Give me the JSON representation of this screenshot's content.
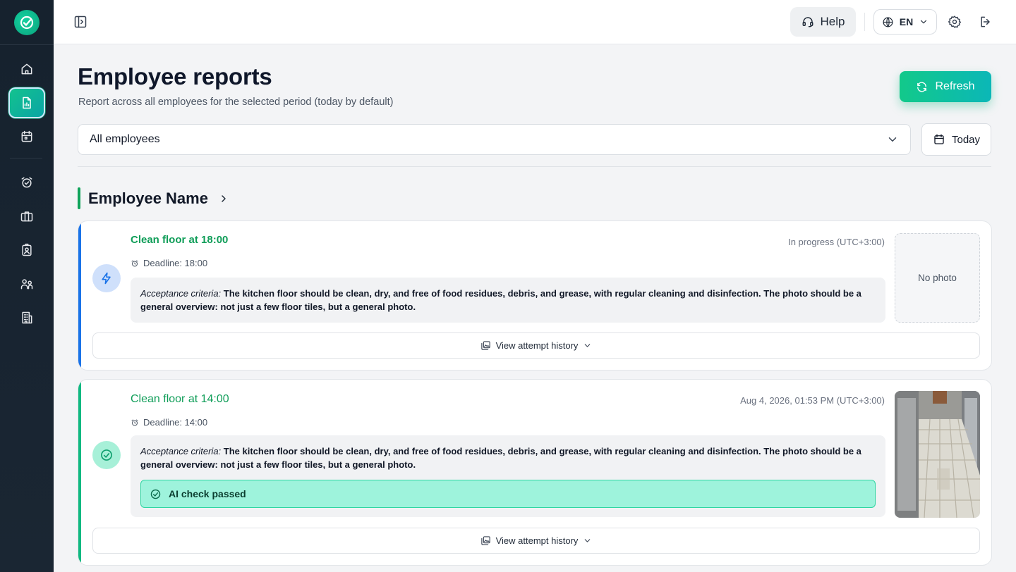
{
  "sidebar": {
    "items": [
      {
        "icon": "home-icon"
      },
      {
        "icon": "report-icon",
        "active": true
      },
      {
        "icon": "calendar-icon"
      },
      {
        "icon": "alarm-check-icon"
      },
      {
        "icon": "briefcase-icon"
      },
      {
        "icon": "id-badge-icon"
      },
      {
        "icon": "users-icon"
      },
      {
        "icon": "building-icon"
      }
    ]
  },
  "topbar": {
    "help_label": "Help",
    "language": "EN"
  },
  "header": {
    "title": "Employee reports",
    "subtitle": "Report across all employees for the selected period (today by default)",
    "refresh_label": "Refresh"
  },
  "filters": {
    "employee_selected": "All employees",
    "date_label": "Today"
  },
  "employee": {
    "name": "Employee Name"
  },
  "tasks": [
    {
      "title": "Clean floor at 18:00",
      "status_text": "In progress (UTC+3:00)",
      "deadline": "Deadline: 18:00",
      "criteria_label": "Acceptance criteria:",
      "criteria_text": " The kitchen floor should be clean, dry, and free of food residues, debris, and grease, with regular cleaning and disinfection. The photo should be a general overview: not just a few floor tiles, but a general photo.",
      "photo_text": "No photo",
      "history_label": "View attempt history",
      "accent": "#1a73e8"
    },
    {
      "title": "Clean floor at 14:00",
      "status_text": "Aug 4, 2026, 01:53 PM (UTC+3:00)",
      "deadline": "Deadline: 14:00",
      "criteria_label": "Acceptance criteria:",
      "criteria_text": " The kitchen floor should be clean, dry, and free of food residues, debris, and grease, with regular cleaning and disinfection. The photo should be a general overview: not just a few floor tiles, but a general photo.",
      "ai_result": "AI check passed",
      "history_label": "View attempt history",
      "accent": "#10b981"
    }
  ]
}
